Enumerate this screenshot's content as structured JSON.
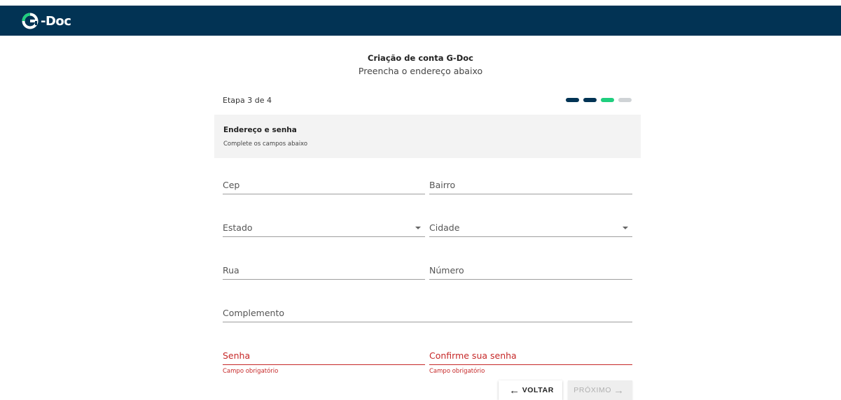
{
  "header": {
    "logo_text": "-Doc",
    "logo_mark": "G",
    "bg_color": "#023354",
    "accent_color": "#1fce7e"
  },
  "page": {
    "title": "Criação de conta G-Doc",
    "subtitle": "Preencha o endereço abaixo"
  },
  "stepper": {
    "label": "Etapa 3 de 4",
    "current": 3,
    "total": 4,
    "colors": {
      "done": "#023354",
      "active": "#1fce7e",
      "pending": "#cfd3d6"
    }
  },
  "section": {
    "title": "Endereço e senha",
    "subtitle": "Complete os campos abaixo"
  },
  "fields": {
    "cep": "Cep",
    "bairro": "Bairro",
    "estado": "Estado",
    "cidade": "Cidade",
    "rua": "Rua",
    "numero": "Número",
    "complemento": "Complemento",
    "senha": "Senha",
    "confirme_senha": "Confirme sua senha"
  },
  "errors": {
    "senha": "Campo obrigatório",
    "confirme_senha": "Campo obrigatório",
    "color": "#c62828"
  },
  "buttons": {
    "back_label": "VOLTAR",
    "next_label": "PRÓXIMO",
    "back_icon": "arrow-left-icon",
    "next_icon": "arrow-right-icon"
  }
}
